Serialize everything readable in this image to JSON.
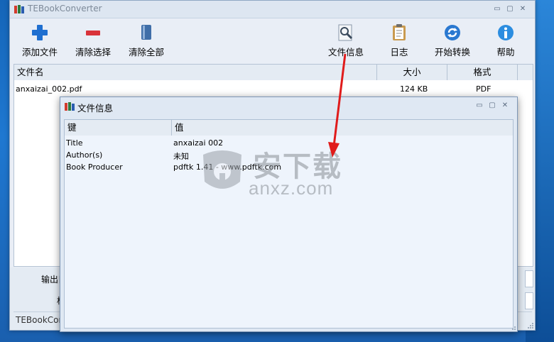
{
  "window": {
    "title": "TEBookConverter",
    "controls": {
      "minimize": "▭",
      "maximize": "▢",
      "close": "✕"
    }
  },
  "toolbar": {
    "buttons": [
      {
        "label": "添加文件",
        "icon": "plus-icon"
      },
      {
        "label": "清除选择",
        "icon": "minus-icon"
      },
      {
        "label": "清除全部",
        "icon": "book-icon"
      },
      {
        "label": "文件信息",
        "icon": "magnifier-icon"
      },
      {
        "label": "日志",
        "icon": "clipboard-icon"
      },
      {
        "label": "开始转换",
        "icon": "refresh-icon"
      },
      {
        "label": "帮助",
        "icon": "info-icon"
      }
    ]
  },
  "file_table": {
    "columns": [
      "文件名",
      "大小",
      "格式"
    ],
    "rows": [
      {
        "name": "anxaizai_002.pdf",
        "size": "124 KB",
        "format": "PDF"
      }
    ]
  },
  "bottom": {
    "output_label": "输出目",
    "format_label_fragment": "格"
  },
  "status": {
    "text": "TEBookConverter"
  },
  "dialog": {
    "title": "文件信息",
    "columns": [
      "键",
      "值"
    ],
    "rows": [
      {
        "key": "Title",
        "value": "anxaizai 002"
      },
      {
        "key": "Author(s)",
        "value": "未知"
      },
      {
        "key": "Book Producer",
        "value": "pdftk 1.41 - www.pdftk.com"
      }
    ]
  },
  "watermark": {
    "chinese": "安下载",
    "latin": "anxz.com"
  },
  "colors": {
    "accent_arrow": "#e01b1b",
    "plus_blue": "#1f6fd0",
    "minus_red": "#d9333a"
  }
}
